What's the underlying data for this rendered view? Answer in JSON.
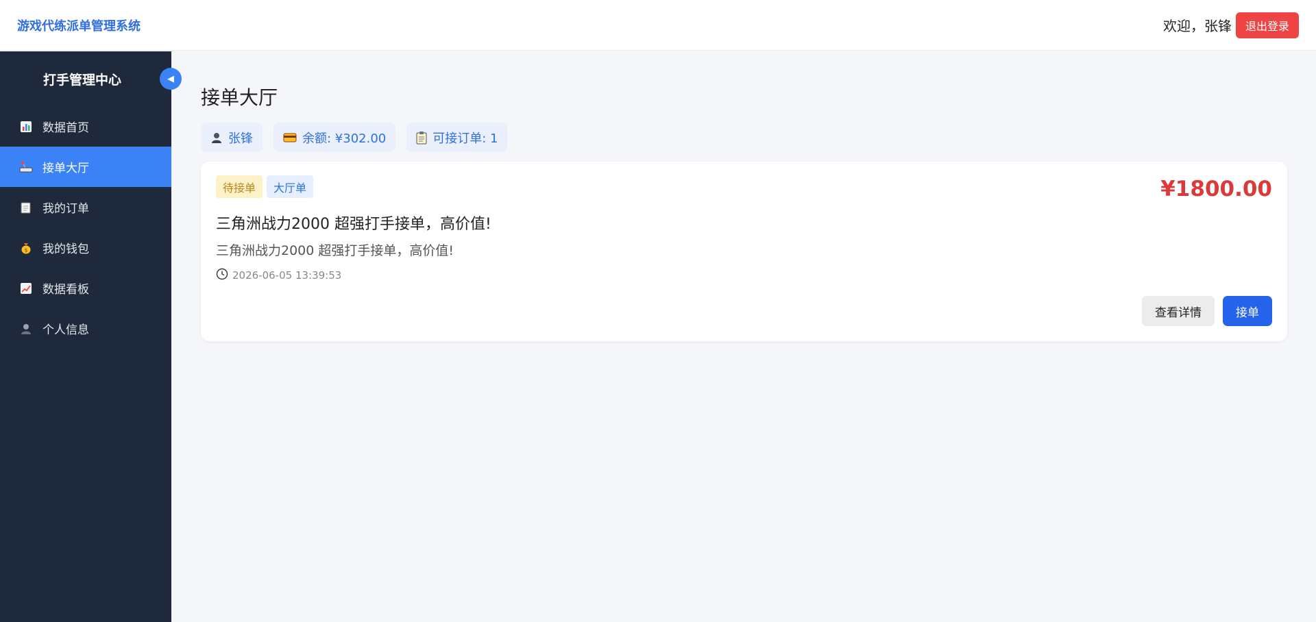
{
  "header": {
    "brand": "游戏代练派单管理系统",
    "welcome": "欢迎，张锋",
    "logout_label": "退出登录"
  },
  "sidebar": {
    "title": "打手管理中心",
    "collapse_glyph": "◀",
    "items": [
      {
        "label": "数据首页",
        "icon": "bar-chart-icon",
        "active": false
      },
      {
        "label": "接单大厅",
        "icon": "joystick-icon",
        "active": true
      },
      {
        "label": "我的订单",
        "icon": "notepad-icon",
        "active": false
      },
      {
        "label": "我的钱包",
        "icon": "money-bag-icon",
        "active": false
      },
      {
        "label": "数据看板",
        "icon": "trend-chart-icon",
        "active": false
      },
      {
        "label": "个人信息",
        "icon": "user-icon",
        "active": false
      }
    ]
  },
  "main": {
    "page_title": "接单大厅",
    "stats": {
      "user": "张锋",
      "balance": "余额: ¥302.00",
      "available_orders": "可接订单: 1"
    },
    "order": {
      "status_tag": "待接单",
      "type_tag": "大厅单",
      "price": "¥1800.00",
      "title": "三角洲战力2000 超强打手接单，高价值!",
      "description": "三角洲战力2000 超强打手接单，高价值!",
      "time": "2026-06-05 13:39:53",
      "detail_label": "查看详情",
      "accept_label": "接单"
    }
  },
  "colors": {
    "accent": "#3b82f6",
    "sidebar_bg": "#1e293b",
    "price": "#d93a3a",
    "danger": "#ef4444"
  }
}
